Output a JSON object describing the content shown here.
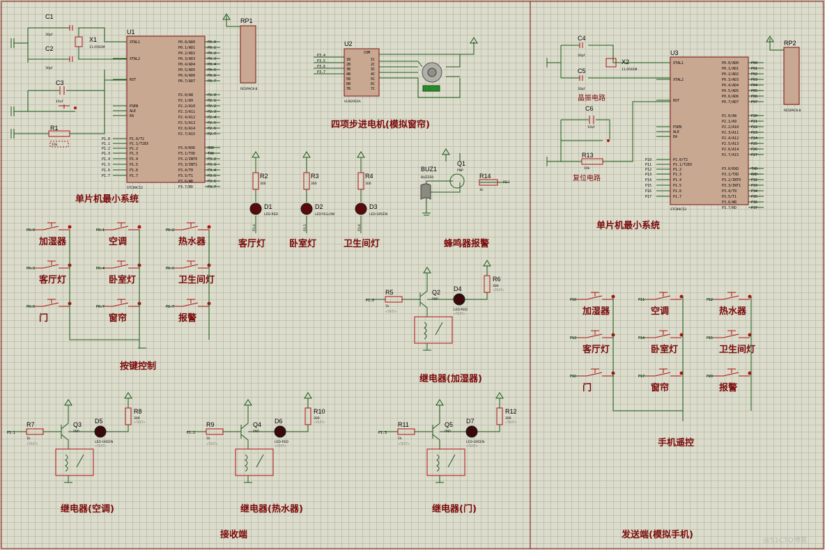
{
  "mcu_left": {
    "ref": "U1",
    "part": "STC89C52",
    "section_label": "单片机最小系统",
    "left_pins": [
      "XTAL1",
      "XTAL2",
      "RST",
      "PSEN",
      "ALE",
      "EA",
      "P1.0/T2",
      "P1.1/T2EX",
      "P1.2",
      "P1.3",
      "P1.4",
      "P1.5",
      "P1.6",
      "P1.7"
    ],
    "right_pins": [
      "P0.0/AD0",
      "P0.1/AD1",
      "P0.2/AD2",
      "P0.3/AD3",
      "P0.4/AD4",
      "P0.5/AD5",
      "P0.6/AD6",
      "P0.7/AD7",
      "P2.0/A8",
      "P2.1/A9",
      "P2.2/A10",
      "P2.3/A11",
      "P2.4/A12",
      "P2.5/A13",
      "P2.6/A14",
      "P2.7/A15",
      "P3.0/RXD",
      "P3.1/TXD",
      "P3.2/INT0",
      "P3.3/INT1",
      "P3.4/T0",
      "P3.5/T1",
      "P3.6/WR",
      "P3.7/RD"
    ],
    "left_nets": [
      "",
      "",
      "",
      "",
      "",
      "",
      "P1.0",
      "P1.1",
      "P1.2",
      "P1.3",
      "P1.4",
      "P1.5",
      "P1.6",
      "P1.7"
    ],
    "right_nets": [
      "P0.0",
      "P0.1",
      "P0.2",
      "P0.3",
      "P0.4",
      "P0.5",
      "P0.6",
      "P0.7",
      "P2.0",
      "P2.1",
      "P2.2",
      "P2.3",
      "P2.4",
      "P2.5",
      "P2.6",
      "P2.7",
      "RXD",
      "TXD",
      "P3.2",
      "P3.3",
      "P3.4",
      "P3.5",
      "P3.6",
      "P3.7"
    ]
  },
  "mcu_right": {
    "ref": "U3",
    "part": "STC89C52",
    "section_label": "单片机最小系统",
    "left_nets": [
      "",
      "",
      "",
      "",
      "",
      "",
      "P10",
      "P11",
      "P12",
      "P13",
      "P14",
      "P15",
      "P16",
      "P17"
    ],
    "right_nets": [
      "P00",
      "P01",
      "P02",
      "P03",
      "P04",
      "P05",
      "P06",
      "P07",
      "P20",
      "P21",
      "P22",
      "P23",
      "P24",
      "P25",
      "P26",
      "P27",
      "TXD",
      "RXD",
      "P32",
      "P33",
      "P34",
      "P35",
      "P36",
      "P37"
    ]
  },
  "osc_left": {
    "c1": "C1",
    "c2": "C2",
    "cval": "30pf",
    "crystal": "X1",
    "freq": "11.0592M",
    "c3": "C3",
    "c3val": "10uf",
    "r1": "R1",
    "r1val": "10k"
  },
  "osc_right": {
    "c4": "C4",
    "c5": "C5",
    "cval": "30pf",
    "crystal": "X2",
    "freq": "11.0592M",
    "c6": "C6",
    "c6val": "10uf",
    "r13": "R13",
    "r13val": "10k",
    "crystal_label": "晶振电路",
    "reset_label": "复位电路"
  },
  "rp1": {
    "ref": "RP1",
    "part": "RESPACK-8"
  },
  "rp2": {
    "ref": "RP2",
    "part": "RESPACK-8"
  },
  "stepper": {
    "ref": "U2",
    "part": "ULN2003A",
    "section_label": "四项步进电机(模拟窗帘)",
    "inputs": [
      "P3.4",
      "P3.5",
      "P3.6",
      "P3.7"
    ],
    "com": "COM",
    "in_pins": [
      "1B",
      "2B",
      "3B",
      "4B",
      "5B",
      "6B",
      "7B"
    ],
    "out_pins": [
      "1C",
      "2C",
      "3C",
      "4C",
      "5C",
      "6C",
      "7C"
    ]
  },
  "lamps": [
    {
      "r": "R2",
      "rv": "300",
      "d": "D1",
      "dp": "LED-RED",
      "net": "P1.4",
      "label": "客厅灯"
    },
    {
      "r": "R3",
      "rv": "300",
      "d": "D2",
      "dp": "LED-YELLOW",
      "net": "P1.5",
      "label": "卧室灯"
    },
    {
      "r": "R4",
      "rv": "300",
      "d": "D3",
      "dp": "LED-GREEN",
      "net": "P1.6",
      "label": "卫生间灯"
    }
  ],
  "buzzer": {
    "ref": "BUZ1",
    "part": "BUZZER",
    "q": "Q1",
    "qp": "PNP",
    "r": "R14",
    "rv": "1k",
    "net": "P2.1",
    "label": "蜂鸣器报警"
  },
  "keys_left": {
    "section_label": "按键控制",
    "items": [
      {
        "net": "P0.0",
        "label": "加湿器"
      },
      {
        "net": "P0.1",
        "label": "空调"
      },
      {
        "net": "P0.2",
        "label": "热水器"
      },
      {
        "net": "P0.3",
        "label": "客厅灯"
      },
      {
        "net": "P0.4",
        "label": "卧室灯"
      },
      {
        "net": "P0.5",
        "label": "卫生间灯"
      },
      {
        "net": "P0.6",
        "label": "门"
      },
      {
        "net": "P0.7",
        "label": "窗帘"
      },
      {
        "net": "P2.7",
        "label": "报警"
      }
    ]
  },
  "keys_right": {
    "section_label": "手机遥控",
    "items": [
      {
        "net": "P10",
        "label": "加湿器"
      },
      {
        "net": "P11",
        "label": "空调"
      },
      {
        "net": "P12",
        "label": "热水器"
      },
      {
        "net": "P13",
        "label": "客厅灯"
      },
      {
        "net": "P14",
        "label": "卧室灯"
      },
      {
        "net": "P15",
        "label": "卫生间灯"
      },
      {
        "net": "P16",
        "label": "门"
      },
      {
        "net": "P17",
        "label": "窗帘"
      },
      {
        "net": "P20",
        "label": "报警"
      }
    ]
  },
  "relays": [
    {
      "r": "R5",
      "rv": "1k",
      "net": "P1.0",
      "q": "Q2",
      "qp": "PNP",
      "d": "D4",
      "dp": "LED-RED",
      "rl": "R6",
      "rlv": "300",
      "label": "继电器(加湿器)"
    },
    {
      "r": "R7",
      "rv": "1k",
      "net": "P1.1",
      "q": "Q3",
      "qp": "PNP",
      "d": "D5",
      "dp": "LED-GREEN",
      "rl": "R8",
      "rlv": "300",
      "label": "继电器(空调)"
    },
    {
      "r": "R9",
      "rv": "1k",
      "net": "P1.2",
      "q": "Q4",
      "qp": "PNP",
      "d": "D6",
      "dp": "LED-RED",
      "rl": "R10",
      "rlv": "300",
      "label": "继电器(热水器)"
    },
    {
      "r": "R11",
      "rv": "1k",
      "net": "P1.3",
      "q": "Q5",
      "qp": "PNP",
      "d": "D7",
      "dp": "LED-GREEN",
      "rl": "R12",
      "rlv": "300",
      "label": "继电器(门)"
    }
  ],
  "footer": {
    "receiver": "接收端",
    "sender": "发送端(模拟手机)",
    "watermark": "@51CTO博客"
  },
  "text_tag": "<TEXT>"
}
